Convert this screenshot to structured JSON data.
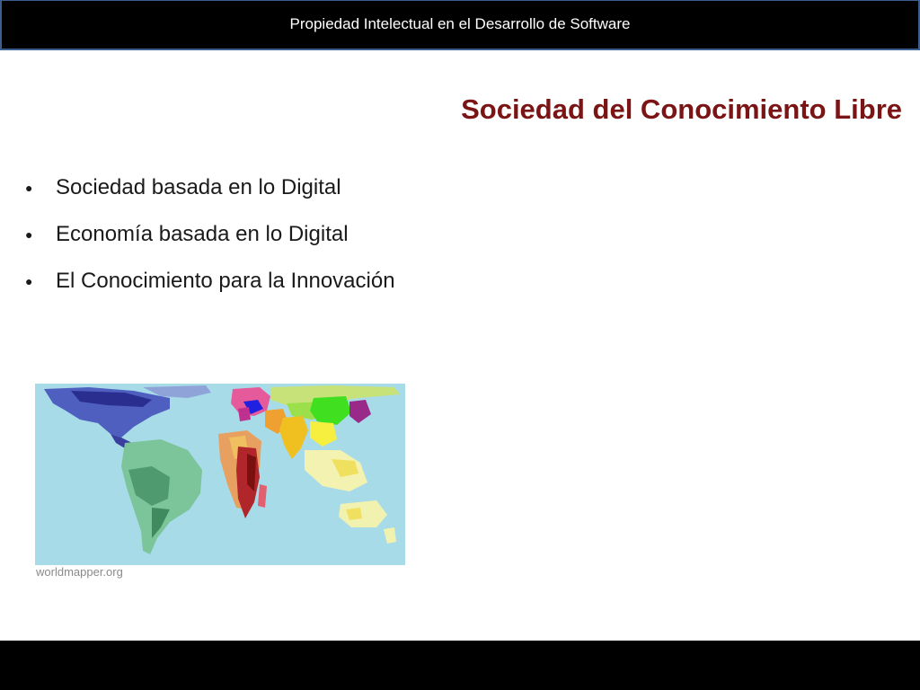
{
  "header": {
    "title": "Propiedad Intelectual en el Desarrollo de Software"
  },
  "slide": {
    "title": "Sociedad del Conocimiento Libre",
    "bullets": [
      {
        "text": "Sociedad basada en lo Digital"
      },
      {
        "text": "Economía basada en lo Digital"
      },
      {
        "text": "El Conocimiento para la Innovación"
      }
    ],
    "bullet_glyph": "●"
  },
  "map": {
    "credit": "worldmapper.org",
    "icon": "world-cartogram-map",
    "colors": {
      "ocean": "#a8dbe8",
      "north_america": "#4f5fbf",
      "south_america": "#5fae7f",
      "africa": "#b0262a",
      "europe": "#e45a9a",
      "asia": "#f0e54a",
      "russia": "#c8e27a",
      "oceania": "#f2f2b0"
    }
  },
  "colors": {
    "header_background": "#000000",
    "header_border": "#3a5f8f",
    "title_color": "#7b1414",
    "footer_background": "#000000"
  }
}
